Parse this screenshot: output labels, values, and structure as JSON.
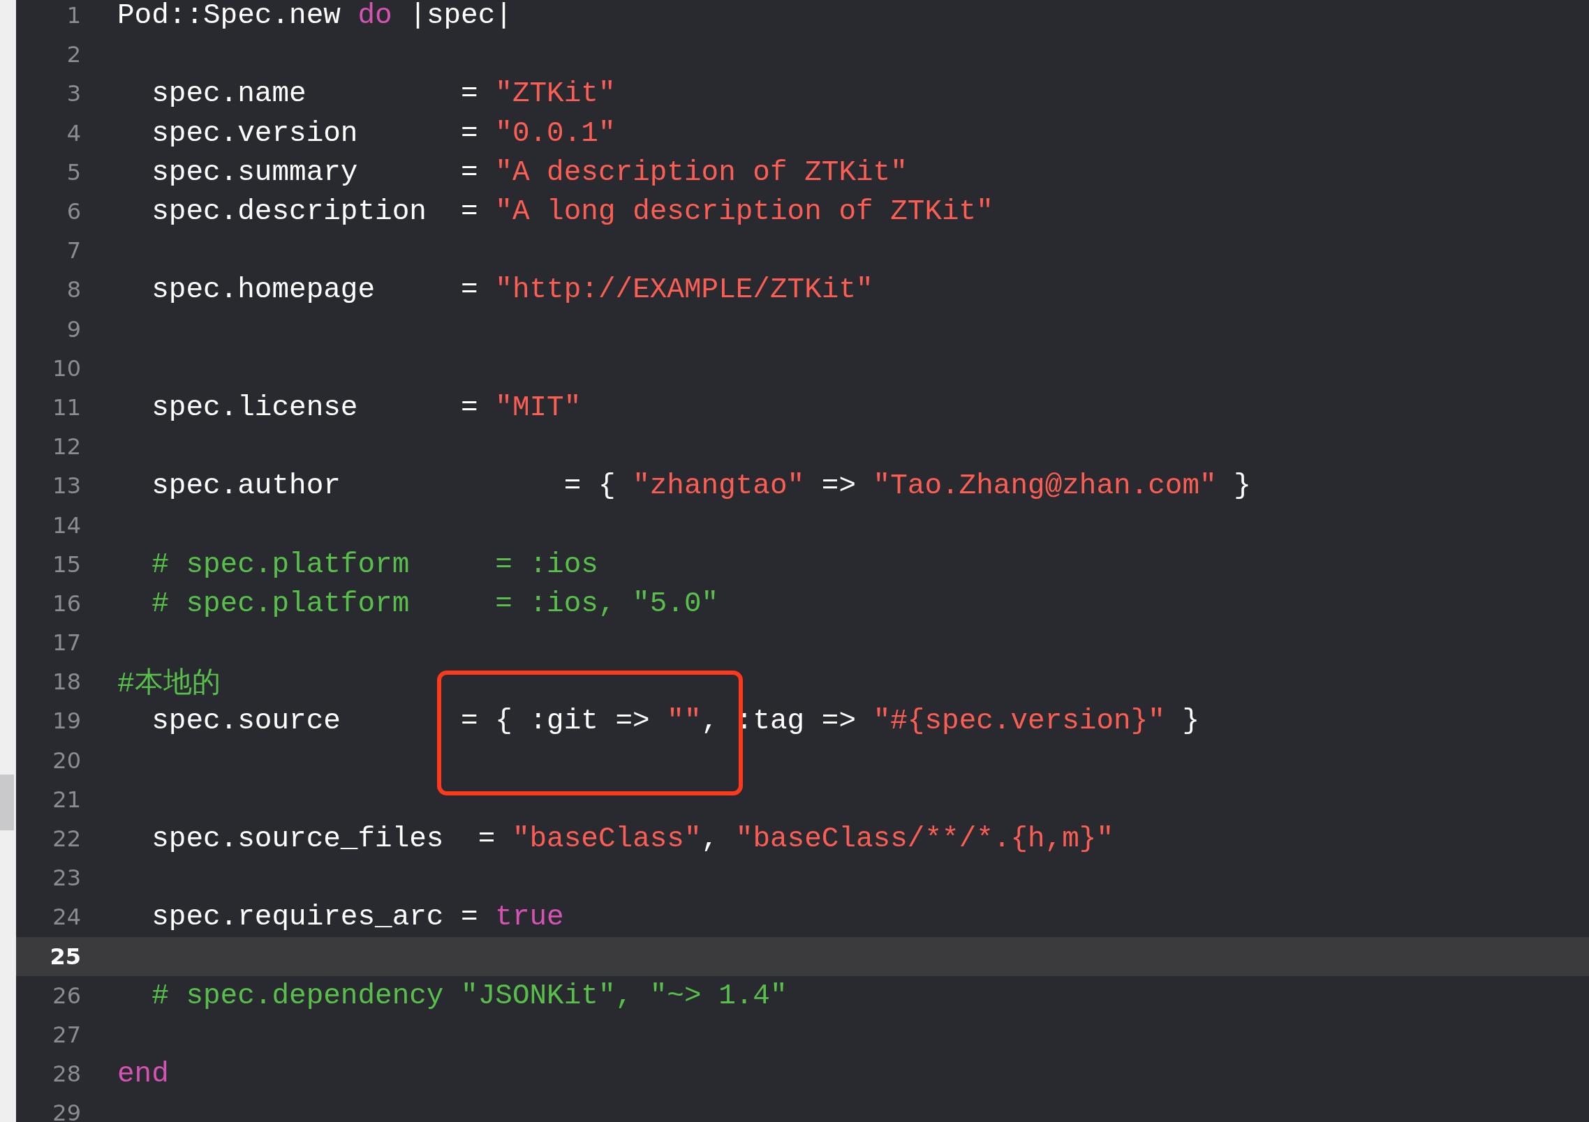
{
  "lines": [
    {
      "number": "1",
      "current": false,
      "tokens": [
        {
          "kind": "plain",
          "text": "Pod::Spec.new "
        },
        {
          "kind": "keyword",
          "text": "do"
        },
        {
          "kind": "plain",
          "text": " |spec|"
        }
      ]
    },
    {
      "number": "2",
      "current": false
    },
    {
      "number": "3",
      "current": false,
      "tokens": [
        {
          "kind": "plain",
          "text": "  spec.name         = "
        },
        {
          "kind": "string",
          "text": "\"ZTKit\""
        }
      ]
    },
    {
      "number": "4",
      "current": false,
      "tokens": [
        {
          "kind": "plain",
          "text": "  spec.version      = "
        },
        {
          "kind": "string",
          "text": "\"0.0.1\""
        }
      ]
    },
    {
      "number": "5",
      "current": false,
      "tokens": [
        {
          "kind": "plain",
          "text": "  spec.summary      = "
        },
        {
          "kind": "string",
          "text": "\"A description of ZTKit\""
        }
      ]
    },
    {
      "number": "6",
      "current": false,
      "tokens": [
        {
          "kind": "plain",
          "text": "  spec.description  = "
        },
        {
          "kind": "string",
          "text": "\"A long description of ZTKit\""
        }
      ]
    },
    {
      "number": "7",
      "current": false
    },
    {
      "number": "8",
      "current": false,
      "tokens": [
        {
          "kind": "plain",
          "text": "  spec.homepage     = "
        },
        {
          "kind": "string",
          "text": "\"http://EXAMPLE/ZTKit\""
        }
      ]
    },
    {
      "number": "9",
      "current": false
    },
    {
      "number": "10",
      "current": false
    },
    {
      "number": "11",
      "current": false,
      "tokens": [
        {
          "kind": "plain",
          "text": "  spec.license      = "
        },
        {
          "kind": "string",
          "text": "\"MIT\""
        }
      ]
    },
    {
      "number": "12",
      "current": false
    },
    {
      "number": "13",
      "current": false,
      "tokens": [
        {
          "kind": "plain",
          "text": "  spec.author             = { "
        },
        {
          "kind": "string",
          "text": "\"zhangtao\""
        },
        {
          "kind": "plain",
          "text": " => "
        },
        {
          "kind": "string",
          "text": "\"Tao.Zhang@zhan.com\""
        },
        {
          "kind": "plain",
          "text": " }"
        }
      ]
    },
    {
      "number": "14",
      "current": false
    },
    {
      "number": "15",
      "current": false,
      "tokens": [
        {
          "kind": "comment",
          "text": "  # spec.platform     = :ios"
        }
      ]
    },
    {
      "number": "16",
      "current": false,
      "tokens": [
        {
          "kind": "comment",
          "text": "  # spec.platform     = :ios, \"5.0\""
        }
      ]
    },
    {
      "number": "17",
      "current": false
    },
    {
      "number": "18",
      "current": false,
      "tokens": [
        {
          "kind": "comment",
          "text": "#本地的"
        }
      ]
    },
    {
      "number": "19",
      "current": false,
      "tokens": [
        {
          "kind": "plain",
          "text": "  spec.source     "
        },
        {
          "kind": "plain",
          "text": "  = { :git => ",
          "boxed": true
        },
        {
          "kind": "string",
          "text": "\"\"",
          "boxed": true
        },
        {
          "kind": "plain",
          "text": ", ",
          "boxed": true
        },
        {
          "kind": "plain",
          "text": ":tag => "
        },
        {
          "kind": "string",
          "text": "\"#{spec.version}\""
        },
        {
          "kind": "plain",
          "text": " }"
        }
      ]
    },
    {
      "number": "20",
      "current": false
    },
    {
      "number": "21",
      "current": false
    },
    {
      "number": "22",
      "current": false,
      "tokens": [
        {
          "kind": "plain",
          "text": "  spec.source_files  = "
        },
        {
          "kind": "string",
          "text": "\"baseClass\""
        },
        {
          "kind": "plain",
          "text": ", "
        },
        {
          "kind": "string",
          "text": "\"baseClass/**/*.{h,m}\""
        }
      ]
    },
    {
      "number": "23",
      "current": false
    },
    {
      "number": "24",
      "current": false,
      "tokens": [
        {
          "kind": "plain",
          "text": "  spec.requires_arc = "
        },
        {
          "kind": "keyword",
          "text": "true"
        }
      ]
    },
    {
      "number": "25",
      "current": true
    },
    {
      "number": "26",
      "current": false,
      "tokens": [
        {
          "kind": "comment",
          "text": "  # spec.dependency \"JSONKit\", \"~> 1.4\""
        }
      ]
    },
    {
      "number": "27",
      "current": false
    },
    {
      "number": "28",
      "current": false,
      "tokens": [
        {
          "kind": "keyword",
          "text": "end"
        }
      ]
    },
    {
      "number": "29",
      "current": false
    }
  ]
}
